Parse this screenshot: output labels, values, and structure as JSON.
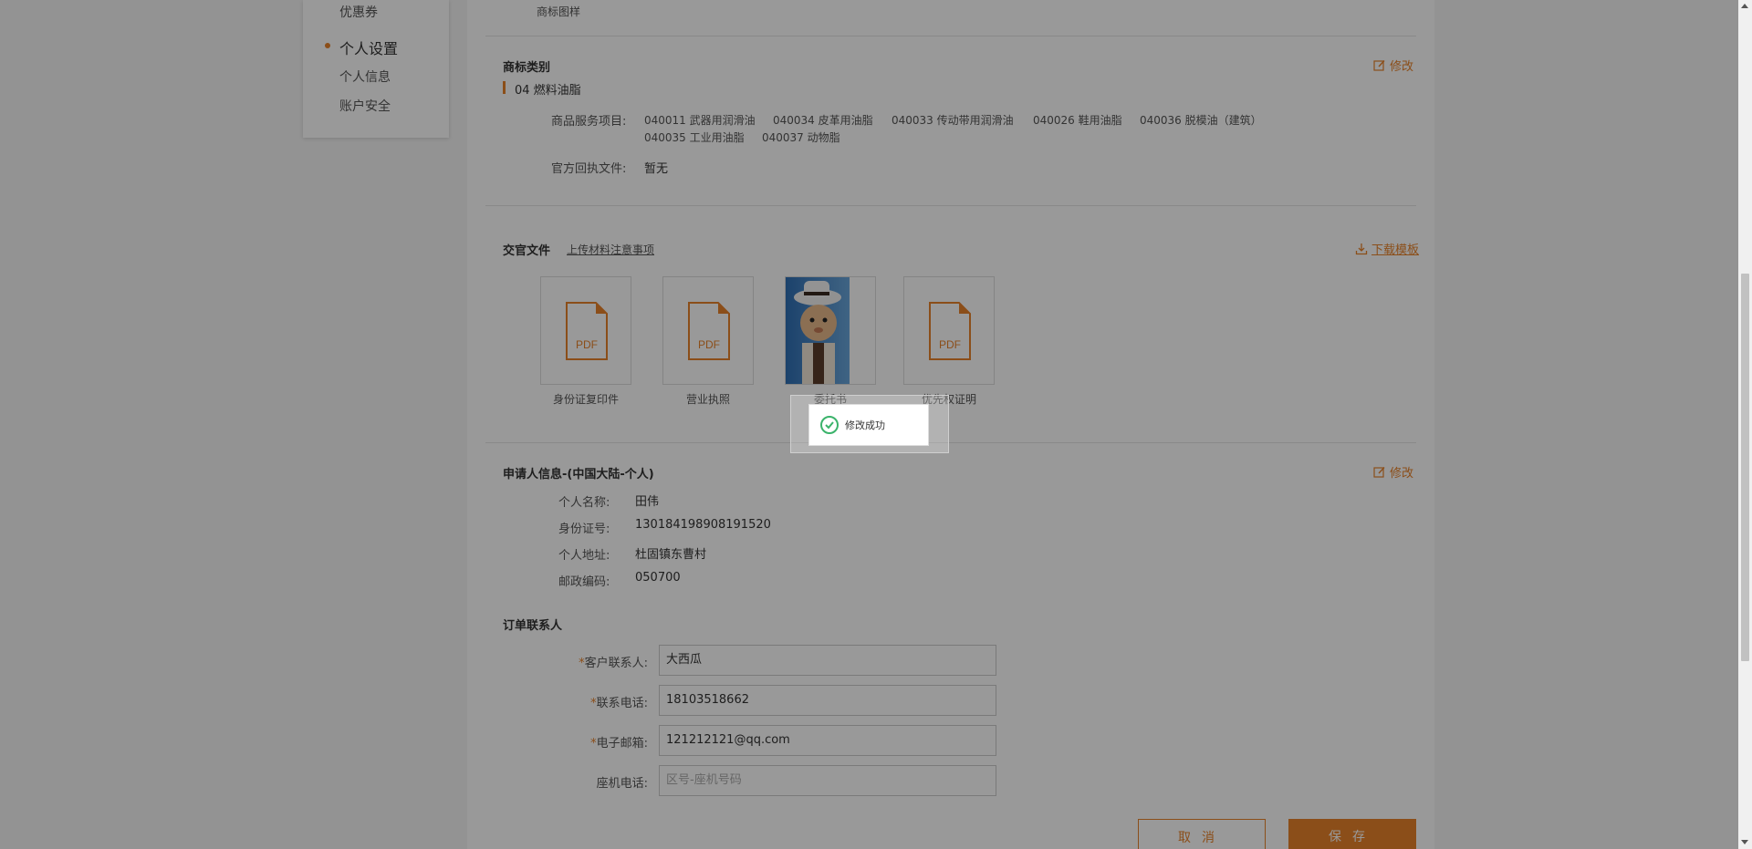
{
  "sidebar": {
    "coupon": "优惠券",
    "settings_heading": "个人设置",
    "personal_info": "个人信息",
    "account_security": "账户安全"
  },
  "trademark_image": {
    "label": "商标图样"
  },
  "trademark_class": {
    "title": "商标类别",
    "edit": "修改",
    "category": "04 燃料油脂",
    "service_label": "商品服务项目:",
    "services": [
      "040011 武器用润滑油",
      "040034 皮革用油脂",
      "040033 传动带用润滑油",
      "040026 鞋用油脂",
      "040036 脱模油（建筑）",
      "040035 工业用油脂",
      "040037 动物脂"
    ],
    "receipt_label": "官方回执文件:",
    "receipt_value": "暂无"
  },
  "documents": {
    "title": "交官文件",
    "notice_link": "上传材料注意事项",
    "download": "下载模板",
    "pdf_text": "PDF",
    "items": [
      {
        "label": "身份证复印件",
        "type": "pdf"
      },
      {
        "label": "营业执照",
        "type": "pdf"
      },
      {
        "label": "委托书",
        "type": "image"
      },
      {
        "label": "优先权证明",
        "type": "pdf"
      }
    ]
  },
  "applicant": {
    "title": "申请人信息-(中国大陆-个人)",
    "edit": "修改",
    "name_label": "个人名称:",
    "name_value": "田伟",
    "id_label": "身份证号:",
    "id_value": "130184198908191520",
    "address_label": "个人地址:",
    "address_value": "杜固镇东曹村",
    "zip_label": "邮政编码:",
    "zip_value": "050700"
  },
  "contact": {
    "title": "订单联系人",
    "required_mark": "*",
    "person_label": "客户联系人:",
    "person_value": "大西瓜",
    "phone_label": "联系电话:",
    "phone_value": "18103518662",
    "email_label": "电子邮箱:",
    "email_value": "121212121@qq.com",
    "landline_label": "座机电话:",
    "landline_placeholder": "区号-座机号码"
  },
  "buttons": {
    "cancel": "取消",
    "save": "保存"
  },
  "toast": {
    "message": "修改成功"
  },
  "colors": {
    "accent": "#e8822a",
    "success": "#3bb36b"
  }
}
